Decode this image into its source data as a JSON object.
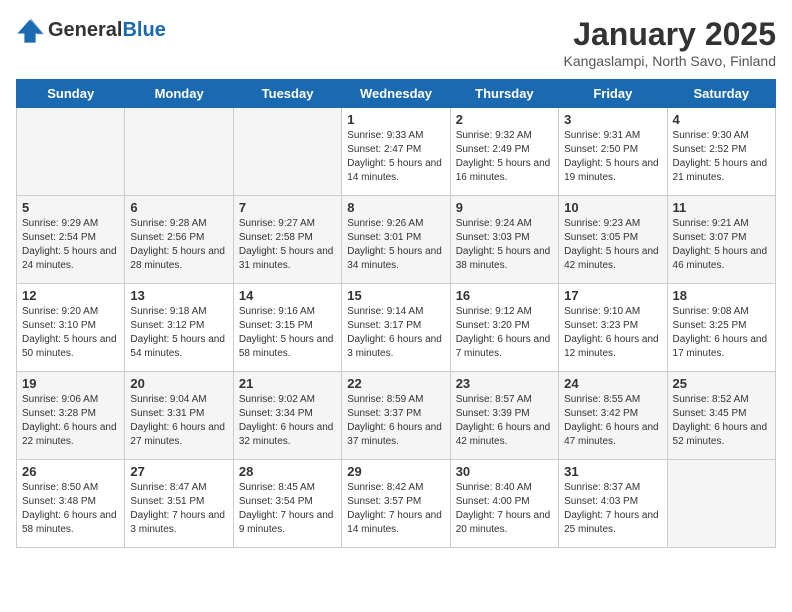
{
  "header": {
    "logo_general": "General",
    "logo_blue": "Blue",
    "title": "January 2025",
    "subtitle": "Kangaslampi, North Savo, Finland"
  },
  "weekdays": [
    "Sunday",
    "Monday",
    "Tuesday",
    "Wednesday",
    "Thursday",
    "Friday",
    "Saturday"
  ],
  "weeks": [
    [
      {
        "day": "",
        "sunrise": "",
        "sunset": "",
        "daylight": ""
      },
      {
        "day": "",
        "sunrise": "",
        "sunset": "",
        "daylight": ""
      },
      {
        "day": "",
        "sunrise": "",
        "sunset": "",
        "daylight": ""
      },
      {
        "day": "1",
        "sunrise": "Sunrise: 9:33 AM",
        "sunset": "Sunset: 2:47 PM",
        "daylight": "Daylight: 5 hours and 14 minutes."
      },
      {
        "day": "2",
        "sunrise": "Sunrise: 9:32 AM",
        "sunset": "Sunset: 2:49 PM",
        "daylight": "Daylight: 5 hours and 16 minutes."
      },
      {
        "day": "3",
        "sunrise": "Sunrise: 9:31 AM",
        "sunset": "Sunset: 2:50 PM",
        "daylight": "Daylight: 5 hours and 19 minutes."
      },
      {
        "day": "4",
        "sunrise": "Sunrise: 9:30 AM",
        "sunset": "Sunset: 2:52 PM",
        "daylight": "Daylight: 5 hours and 21 minutes."
      }
    ],
    [
      {
        "day": "5",
        "sunrise": "Sunrise: 9:29 AM",
        "sunset": "Sunset: 2:54 PM",
        "daylight": "Daylight: 5 hours and 24 minutes."
      },
      {
        "day": "6",
        "sunrise": "Sunrise: 9:28 AM",
        "sunset": "Sunset: 2:56 PM",
        "daylight": "Daylight: 5 hours and 28 minutes."
      },
      {
        "day": "7",
        "sunrise": "Sunrise: 9:27 AM",
        "sunset": "Sunset: 2:58 PM",
        "daylight": "Daylight: 5 hours and 31 minutes."
      },
      {
        "day": "8",
        "sunrise": "Sunrise: 9:26 AM",
        "sunset": "Sunset: 3:01 PM",
        "daylight": "Daylight: 5 hours and 34 minutes."
      },
      {
        "day": "9",
        "sunrise": "Sunrise: 9:24 AM",
        "sunset": "Sunset: 3:03 PM",
        "daylight": "Daylight: 5 hours and 38 minutes."
      },
      {
        "day": "10",
        "sunrise": "Sunrise: 9:23 AM",
        "sunset": "Sunset: 3:05 PM",
        "daylight": "Daylight: 5 hours and 42 minutes."
      },
      {
        "day": "11",
        "sunrise": "Sunrise: 9:21 AM",
        "sunset": "Sunset: 3:07 PM",
        "daylight": "Daylight: 5 hours and 46 minutes."
      }
    ],
    [
      {
        "day": "12",
        "sunrise": "Sunrise: 9:20 AM",
        "sunset": "Sunset: 3:10 PM",
        "daylight": "Daylight: 5 hours and 50 minutes."
      },
      {
        "day": "13",
        "sunrise": "Sunrise: 9:18 AM",
        "sunset": "Sunset: 3:12 PM",
        "daylight": "Daylight: 5 hours and 54 minutes."
      },
      {
        "day": "14",
        "sunrise": "Sunrise: 9:16 AM",
        "sunset": "Sunset: 3:15 PM",
        "daylight": "Daylight: 5 hours and 58 minutes."
      },
      {
        "day": "15",
        "sunrise": "Sunrise: 9:14 AM",
        "sunset": "Sunset: 3:17 PM",
        "daylight": "Daylight: 6 hours and 3 minutes."
      },
      {
        "day": "16",
        "sunrise": "Sunrise: 9:12 AM",
        "sunset": "Sunset: 3:20 PM",
        "daylight": "Daylight: 6 hours and 7 minutes."
      },
      {
        "day": "17",
        "sunrise": "Sunrise: 9:10 AM",
        "sunset": "Sunset: 3:23 PM",
        "daylight": "Daylight: 6 hours and 12 minutes."
      },
      {
        "day": "18",
        "sunrise": "Sunrise: 9:08 AM",
        "sunset": "Sunset: 3:25 PM",
        "daylight": "Daylight: 6 hours and 17 minutes."
      }
    ],
    [
      {
        "day": "19",
        "sunrise": "Sunrise: 9:06 AM",
        "sunset": "Sunset: 3:28 PM",
        "daylight": "Daylight: 6 hours and 22 minutes."
      },
      {
        "day": "20",
        "sunrise": "Sunrise: 9:04 AM",
        "sunset": "Sunset: 3:31 PM",
        "daylight": "Daylight: 6 hours and 27 minutes."
      },
      {
        "day": "21",
        "sunrise": "Sunrise: 9:02 AM",
        "sunset": "Sunset: 3:34 PM",
        "daylight": "Daylight: 6 hours and 32 minutes."
      },
      {
        "day": "22",
        "sunrise": "Sunrise: 8:59 AM",
        "sunset": "Sunset: 3:37 PM",
        "daylight": "Daylight: 6 hours and 37 minutes."
      },
      {
        "day": "23",
        "sunrise": "Sunrise: 8:57 AM",
        "sunset": "Sunset: 3:39 PM",
        "daylight": "Daylight: 6 hours and 42 minutes."
      },
      {
        "day": "24",
        "sunrise": "Sunrise: 8:55 AM",
        "sunset": "Sunset: 3:42 PM",
        "daylight": "Daylight: 6 hours and 47 minutes."
      },
      {
        "day": "25",
        "sunrise": "Sunrise: 8:52 AM",
        "sunset": "Sunset: 3:45 PM",
        "daylight": "Daylight: 6 hours and 52 minutes."
      }
    ],
    [
      {
        "day": "26",
        "sunrise": "Sunrise: 8:50 AM",
        "sunset": "Sunset: 3:48 PM",
        "daylight": "Daylight: 6 hours and 58 minutes."
      },
      {
        "day": "27",
        "sunrise": "Sunrise: 8:47 AM",
        "sunset": "Sunset: 3:51 PM",
        "daylight": "Daylight: 7 hours and 3 minutes."
      },
      {
        "day": "28",
        "sunrise": "Sunrise: 8:45 AM",
        "sunset": "Sunset: 3:54 PM",
        "daylight": "Daylight: 7 hours and 9 minutes."
      },
      {
        "day": "29",
        "sunrise": "Sunrise: 8:42 AM",
        "sunset": "Sunset: 3:57 PM",
        "daylight": "Daylight: 7 hours and 14 minutes."
      },
      {
        "day": "30",
        "sunrise": "Sunrise: 8:40 AM",
        "sunset": "Sunset: 4:00 PM",
        "daylight": "Daylight: 7 hours and 20 minutes."
      },
      {
        "day": "31",
        "sunrise": "Sunrise: 8:37 AM",
        "sunset": "Sunset: 4:03 PM",
        "daylight": "Daylight: 7 hours and 25 minutes."
      },
      {
        "day": "",
        "sunrise": "",
        "sunset": "",
        "daylight": ""
      }
    ]
  ]
}
